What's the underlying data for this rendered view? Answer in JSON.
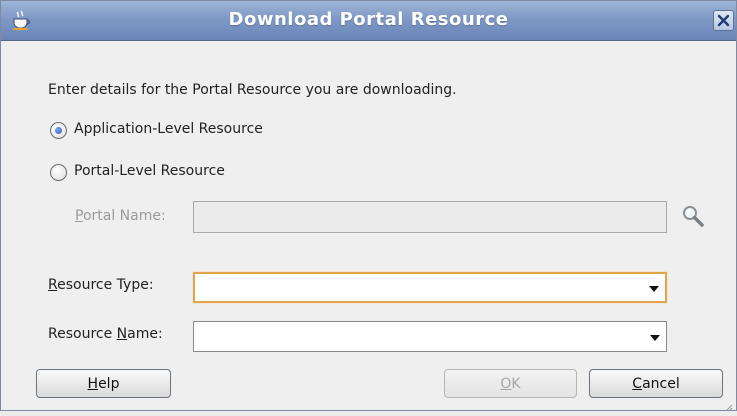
{
  "window": {
    "title": "Download Portal Resource",
    "icon": "coffee-cup-icon",
    "close_icon": "close-icon"
  },
  "form": {
    "instruction": "Enter details for the Portal Resource you are downloading.",
    "radio_application": {
      "label": "Application-Level Resource",
      "checked": true
    },
    "radio_portal": {
      "label": "Portal-Level Resource",
      "checked": false
    },
    "portal_name": {
      "mnemonic": "P",
      "label_rest": "ortal Name:",
      "value": "",
      "enabled": false
    },
    "resource_type": {
      "mnemonic": "R",
      "label_rest": "esource Type:",
      "value": ""
    },
    "resource_name": {
      "label_pre": "Resource ",
      "mnemonic": "N",
      "label_rest": "ame:",
      "value": ""
    }
  },
  "buttons": {
    "help": {
      "mnemonic": "H",
      "rest": "elp"
    },
    "ok": {
      "mnemonic": "O",
      "rest": "K",
      "enabled": false
    },
    "cancel": {
      "mnemonic": "C",
      "rest": "ancel"
    }
  },
  "colors": {
    "titlebar": "#7f99c6",
    "focus_border": "#e3a54b",
    "radio_selected": "#2c5fb8"
  }
}
